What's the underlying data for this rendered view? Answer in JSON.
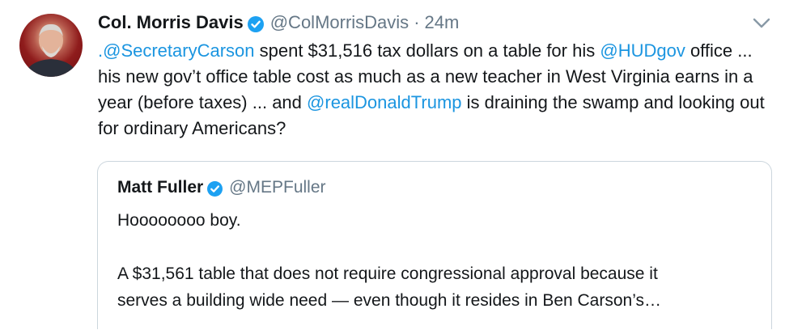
{
  "tweet": {
    "author_name": "Col. Morris Davis",
    "author_handle": "@ColMorrisDavis",
    "separator": "·",
    "timestamp": "24m",
    "text_parts": {
      "mention1": ".@SecretaryCarson",
      "t1": " spent $31,516 tax dollars on a table for his ",
      "mention2": "@HUDgov",
      "t2": " office ... his new gov’t office table cost as much as a new teacher in West Virginia earns in a year (before taxes) ... and ",
      "mention3": "@realDonaldTrump",
      "t3": " is draining the swamp and looking out for ordinary Americans?"
    }
  },
  "quoted_tweet": {
    "author_name": "Matt Fuller",
    "author_handle": "@MEPFuller",
    "line1": "Hoooooooo boy.",
    "line2": "A $31,561 table that does not require congressional approval because it",
    "line3": "serves a building wide need — even though it resides in Ben Carson’s…"
  },
  "colors": {
    "link": "#1b95e0",
    "verified_badge": "#1da1f2",
    "secondary_text": "#657786",
    "border": "#ccd6dd"
  },
  "icons": {
    "verified": "verified-badge-icon",
    "menu": "chevron-down-icon"
  }
}
